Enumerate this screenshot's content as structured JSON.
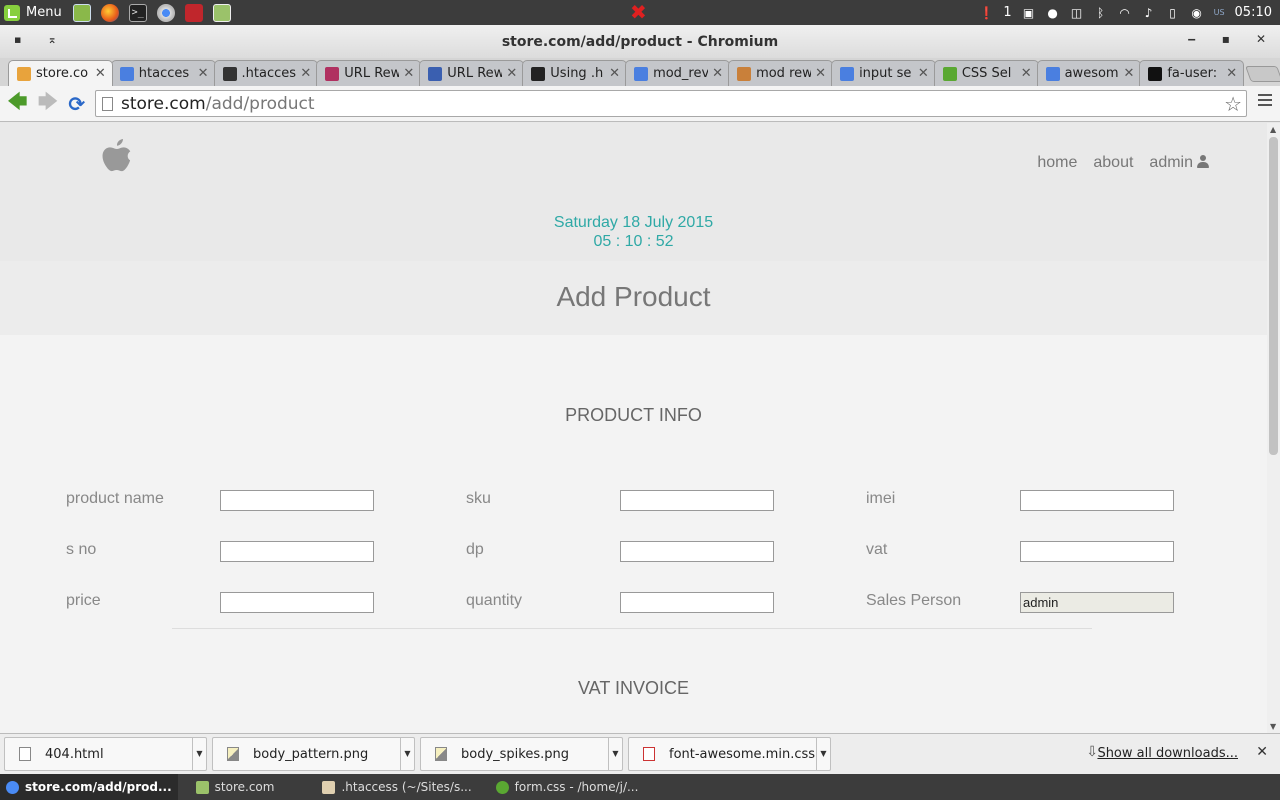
{
  "panel": {
    "menu_label": "Menu",
    "notification_count": "1",
    "keyboard_layout": "US",
    "clock": "05:10"
  },
  "window": {
    "title": "store.com/add/product - Chromium"
  },
  "tabs": [
    {
      "title": "store.co",
      "icon": "store-favicon",
      "color": "#e8a33c"
    },
    {
      "title": "htacces",
      "icon": "google-favicon",
      "color": "#4a7fe0"
    },
    {
      "title": ".htacces",
      "icon": "regex-favicon",
      "color": "#333333"
    },
    {
      "title": "URL Rew",
      "icon": "feather-favicon",
      "color": "#b03060"
    },
    {
      "title": "URL Rew",
      "icon": "iis-favicon",
      "color": "#3a5fb0"
    },
    {
      "title": "Using .h",
      "icon": "mt-favicon",
      "color": "#222222"
    },
    {
      "title": "mod_rev",
      "icon": "google-favicon",
      "color": "#4a7fe0"
    },
    {
      "title": "mod rew",
      "icon": "feather-favicon",
      "color": "#c9803a"
    },
    {
      "title": "input se",
      "icon": "google-favicon",
      "color": "#4a7fe0"
    },
    {
      "title": "CSS Sel",
      "icon": "w3-favicon",
      "color": "#5aa832"
    },
    {
      "title": "awesom",
      "icon": "google-favicon",
      "color": "#4a7fe0"
    },
    {
      "title": "fa-user:",
      "icon": "flag-favicon",
      "color": "#111111"
    }
  ],
  "address_bar": {
    "host": "store.com",
    "path": "/add/product"
  },
  "site": {
    "nav": {
      "home": "home",
      "about": "about",
      "admin": "admin"
    },
    "date": "Saturday 18 July 2015",
    "time": "05 : 10 : 52",
    "page_title": "Add Product",
    "product_info_heading": "PRODUCT INFO",
    "vat_invoice_heading": "VAT INVOICE",
    "fields": {
      "product_name": {
        "label": "product name",
        "value": ""
      },
      "sku": {
        "label": "sku",
        "value": ""
      },
      "imei": {
        "label": "imei",
        "value": ""
      },
      "s_no": {
        "label": "s no",
        "value": ""
      },
      "dp": {
        "label": "dp",
        "value": ""
      },
      "vat": {
        "label": "vat",
        "value": ""
      },
      "price": {
        "label": "price",
        "value": ""
      },
      "quantity": {
        "label": "quantity",
        "value": ""
      },
      "sales_person": {
        "label": "Sales Person",
        "value": "admin"
      }
    }
  },
  "downloads": {
    "items": [
      "404.html",
      "body_pattern.png",
      "body_spikes.png",
      "font-awesome.min.css"
    ],
    "show_all": "Show all downloads..."
  },
  "taskbar": {
    "items": [
      "store.com/add/prod...",
      "store.com",
      ".htaccess (~/Sites/s...",
      "form.css - /home/j/..."
    ]
  }
}
